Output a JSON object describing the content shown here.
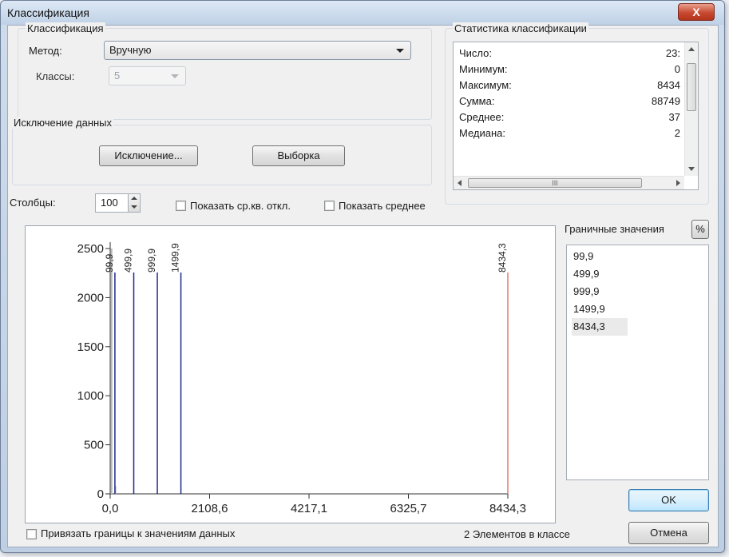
{
  "window": {
    "title": "Классификация",
    "close_glyph": "X"
  },
  "classification": {
    "group_label": "Классификация",
    "method_label": "Метод:",
    "method_value": "Вручную",
    "classes_label": "Классы:",
    "classes_value": "5",
    "exclusion_group_label": "Исключение данных",
    "exclusion_button": "Исключение...",
    "sampling_button": "Выборка"
  },
  "statistics": {
    "group_label": "Статистика классификации",
    "rows": [
      {
        "key": "Число:",
        "value": "23:"
      },
      {
        "key": "Минимум:",
        "value": "0"
      },
      {
        "key": "Максимум:",
        "value": "8434"
      },
      {
        "key": "Сумма:",
        "value": "88749"
      },
      {
        "key": "Среднее:",
        "value": "37"
      },
      {
        "key": "Медиана:",
        "value": "2"
      }
    ],
    "hscroll_grip": "III"
  },
  "options": {
    "columns_label": "Столбцы:",
    "columns_value": "100",
    "show_std_label": "Показать ср.кв. откл.",
    "show_mean_label": "Показать среднее"
  },
  "chart_data": {
    "type": "bar",
    "y_ticks": [
      "0",
      "500",
      "1000",
      "1500",
      "2000",
      "2500"
    ],
    "x_ticks": [
      "0,0",
      "2108,6",
      "4217,1",
      "6325,7",
      "8434,3"
    ],
    "ylim": [
      0,
      2500
    ],
    "xlim": [
      0,
      8434.3
    ],
    "histogram": [
      {
        "x": 30,
        "y": 2500
      },
      {
        "x": 110,
        "y": 80
      }
    ],
    "break_lines": [
      {
        "x": 99.9,
        "label": "99,9",
        "color": "#1e2a8c"
      },
      {
        "x": 499.9,
        "label": "499,9",
        "color": "#1e2a8c"
      },
      {
        "x": 999.9,
        "label": "999,9",
        "color": "#1e2a8c"
      },
      {
        "x": 1499.9,
        "label": "1499,9",
        "color": "#1e2a8c"
      },
      {
        "x": 8434.3,
        "label": "8434,3",
        "color": "#e07a6a"
      }
    ]
  },
  "bounds": {
    "label": "Граничные значения",
    "percent_button": "%",
    "values": [
      "99,9",
      "499,9",
      "999,9",
      "1499,9",
      "8434,3"
    ],
    "selected_index": 4
  },
  "footer": {
    "snap_label": "Привязать границы к значениям данных",
    "elements_text": "2 Элементов в классе",
    "ok_button": "OK",
    "cancel_button": "Отмена"
  }
}
